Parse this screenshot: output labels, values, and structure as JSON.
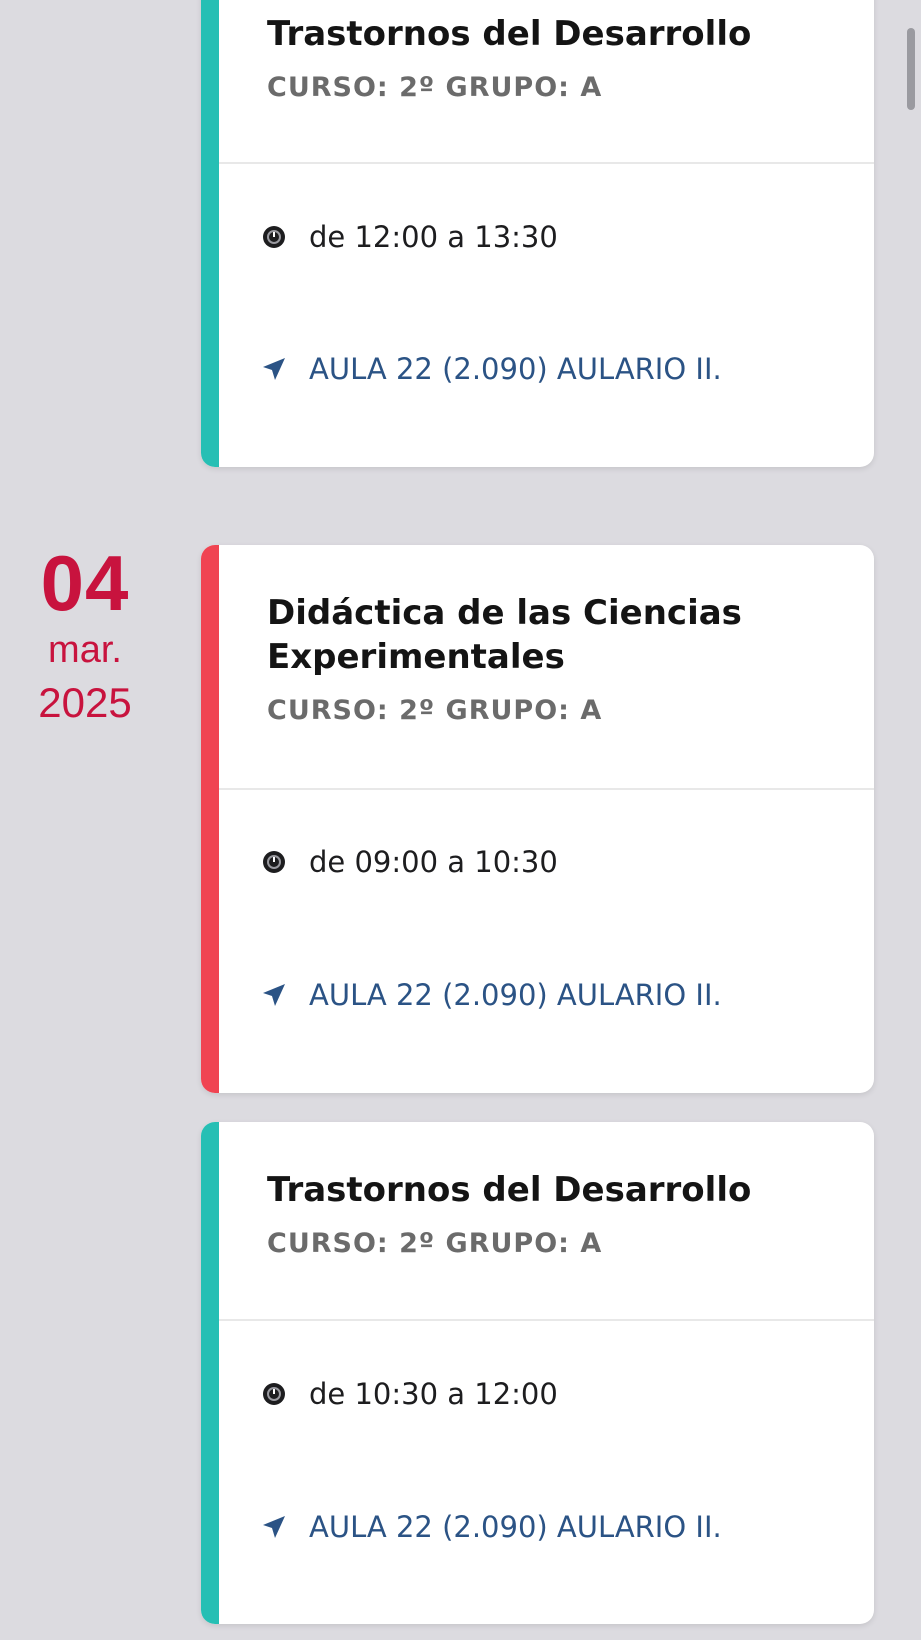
{
  "colors": {
    "background": "#dcdbe0",
    "date_accent": "#c8133e",
    "teal_accent": "#26bfb4",
    "red_accent": "#f04452",
    "room_text": "#2b5385",
    "subtitle_text": "#6b6b6b"
  },
  "date": {
    "day": "04",
    "month": "mar.",
    "year": "2025"
  },
  "cards": [
    {
      "title": "Trastornos del Desarrollo",
      "subtitle": "CURSO: 2º GRUPO: A",
      "time": "de 12:00 a 13:30",
      "room": "AULA 22 (2.090) AULARIO II.",
      "accent": "teal",
      "time_icon": "clock-icon",
      "room_icon": "location-arrow-icon"
    },
    {
      "title": "Didáctica de las Ciencias Experimentales",
      "subtitle": "CURSO: 2º GRUPO: A",
      "time": "de 09:00 a 10:30",
      "room": "AULA 22 (2.090) AULARIO II.",
      "accent": "red",
      "time_icon": "clock-icon",
      "room_icon": "location-arrow-icon"
    },
    {
      "title": "Trastornos del Desarrollo",
      "subtitle": "CURSO: 2º GRUPO: A",
      "time": "de 10:30 a 12:00",
      "room": "AULA 22 (2.090) AULARIO II.",
      "accent": "teal",
      "time_icon": "clock-icon",
      "room_icon": "location-arrow-icon"
    }
  ]
}
